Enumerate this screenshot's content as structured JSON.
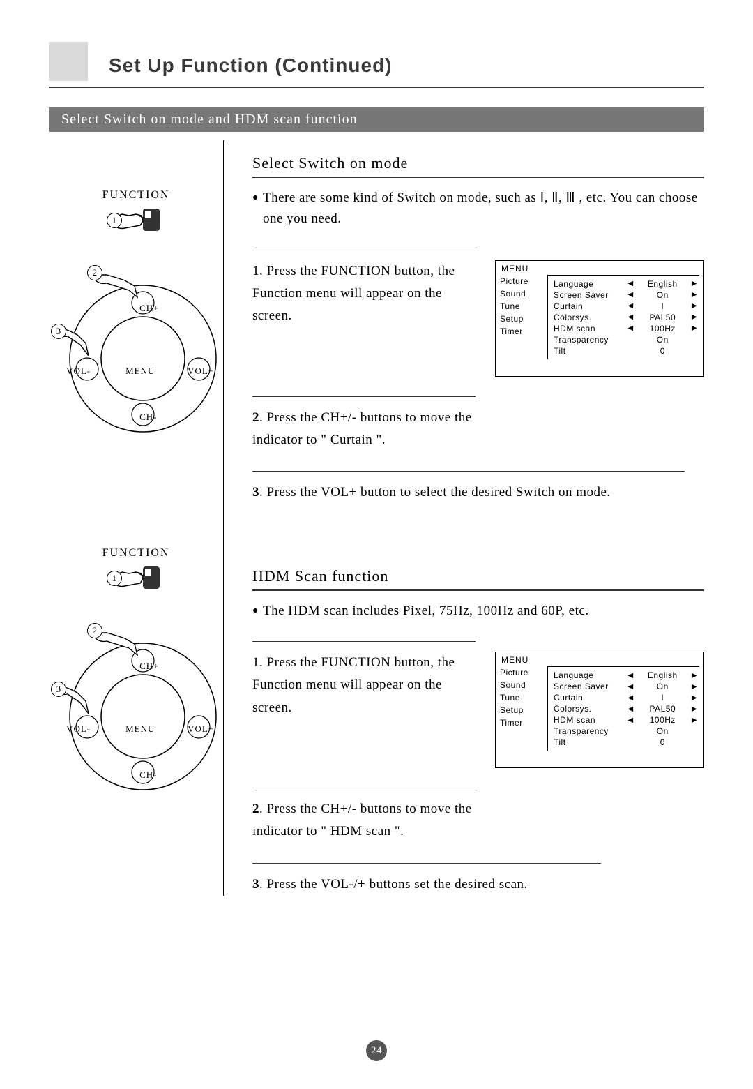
{
  "title": "Set Up Function (Continued)",
  "sectionBar": "Select Switch on mode and HDM scan function",
  "sectionA": {
    "heading": "Select Switch on mode",
    "intro": "There are some kind of Switch on mode, such as Ⅰ, Ⅱ, Ⅲ , etc. You can choose one you need.",
    "step1": "1. Press the FUNCTION button, the Function menu will appear on the screen.",
    "step2num": "2",
    "step2": ". Press the CH+/- buttons to move the indicator to \" Curtain \".",
    "step3num": "3",
    "step3": ". Press the VOL+ button to select the desired Switch on mode."
  },
  "sectionB": {
    "heading": "HDM Scan function",
    "intro": "The HDM scan includes Pixel, 75Hz, 100Hz and 60P, etc.",
    "step1": "1. Press the FUNCTION button, the Function menu will appear on the screen.",
    "step2num": "2",
    "step2": ". Press the CH+/- buttons to move the indicator to \" HDM scan \".",
    "step3num": "3",
    "step3": ". Press the VOL-/+ buttons set the desired scan."
  },
  "controls": {
    "functionLabel": "FUNCTION",
    "chPlus": "CH+",
    "chMinus": "CH-",
    "volMinus": "VOL-",
    "volPlus": "VOL+",
    "menu": "MENU",
    "badge1": "1",
    "badge2": "2",
    "badge3": "3"
  },
  "menu": {
    "header": "MENU",
    "left": [
      "Picture",
      "Sound",
      "Tune",
      "Setup",
      "Timer"
    ],
    "rows": [
      {
        "label": "Language",
        "left": "◀",
        "value": "English",
        "right": "▶"
      },
      {
        "label": "Screen Saver",
        "left": "◀",
        "value": "On",
        "right": "▶"
      },
      {
        "label": "Curtain",
        "left": "◀",
        "value": "I",
        "right": "▶"
      },
      {
        "label": "Colorsys.",
        "left": "◀",
        "value": "PAL50",
        "right": "▶"
      },
      {
        "label": "HDM scan",
        "left": "◀",
        "value": "100Hz",
        "right": "▶"
      },
      {
        "label": "Transparency",
        "left": "",
        "value": "On",
        "right": ""
      },
      {
        "label": "Tilt",
        "left": "",
        "value": "0",
        "right": ""
      }
    ]
  },
  "pageNumber": "24"
}
